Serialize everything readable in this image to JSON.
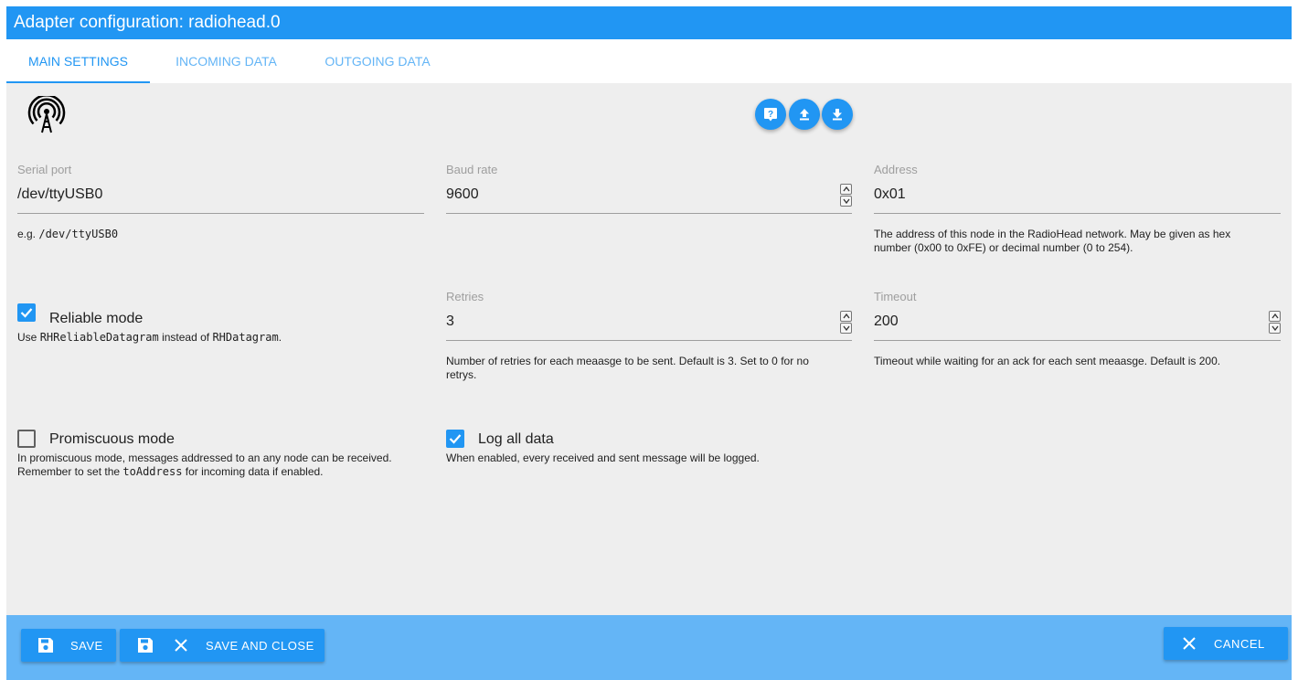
{
  "window": {
    "title": "Adapter configuration: radiohead.0"
  },
  "tabs": [
    {
      "label": "MAIN SETTINGS"
    },
    {
      "label": "INCOMING DATA"
    },
    {
      "label": "OUTGOING DATA"
    }
  ],
  "header": {
    "logo_icon": "radio-tower-icon",
    "actions": [
      "help-icon",
      "upload-icon",
      "download-icon"
    ]
  },
  "fields": {
    "serial_port": {
      "label": "Serial port",
      "value": "/dev/ttyUSB0",
      "help_prefix": "e.g. ",
      "help_code": "/dev/ttyUSB0"
    },
    "baud_rate": {
      "label": "Baud rate",
      "value": "9600"
    },
    "address": {
      "label": "Address",
      "value": "0x01",
      "help_line1": "The address of this node in the RadioHead network. May be given as hex",
      "help_line2": "number (0x00 to 0xFE) or decimal number (0 to 254)."
    },
    "retries": {
      "label": "Retries",
      "value": "3",
      "help_line1": "Number of retries for each meaasge to be sent. Default is 3. Set to 0 for no",
      "help_line2": "retrys."
    },
    "timeout": {
      "label": "Timeout",
      "value": "200",
      "help_line1": "Timeout while waiting for an ack for each sent meaasge. Default is 200."
    }
  },
  "checkboxes": {
    "reliable": {
      "label": "Reliable mode",
      "checked": true,
      "help_pre": "Use ",
      "help_code1": "RHReliableDatagram",
      "help_mid": " instead of ",
      "help_code2": "RHDatagram",
      "help_post": "."
    },
    "promiscuous": {
      "label": "Promiscuous mode",
      "checked": false,
      "help_line1": "In promiscuous mode, messages addressed to an any node can be received.",
      "help_line2_pre": "Remember to set the ",
      "help_line2_code": "toAddress",
      "help_line2_post": " for incoming data if enabled."
    },
    "log_all": {
      "label": "Log all data",
      "checked": true,
      "help_line1": "When enabled, every received and sent message will be logged."
    }
  },
  "footer": {
    "save_label": "SAVE",
    "save_close_label": "SAVE AND CLOSE",
    "cancel_label": "CANCEL"
  },
  "colors": {
    "primary": "#2196f3",
    "footer": "#64b5f6",
    "background": "#eeeeee"
  }
}
